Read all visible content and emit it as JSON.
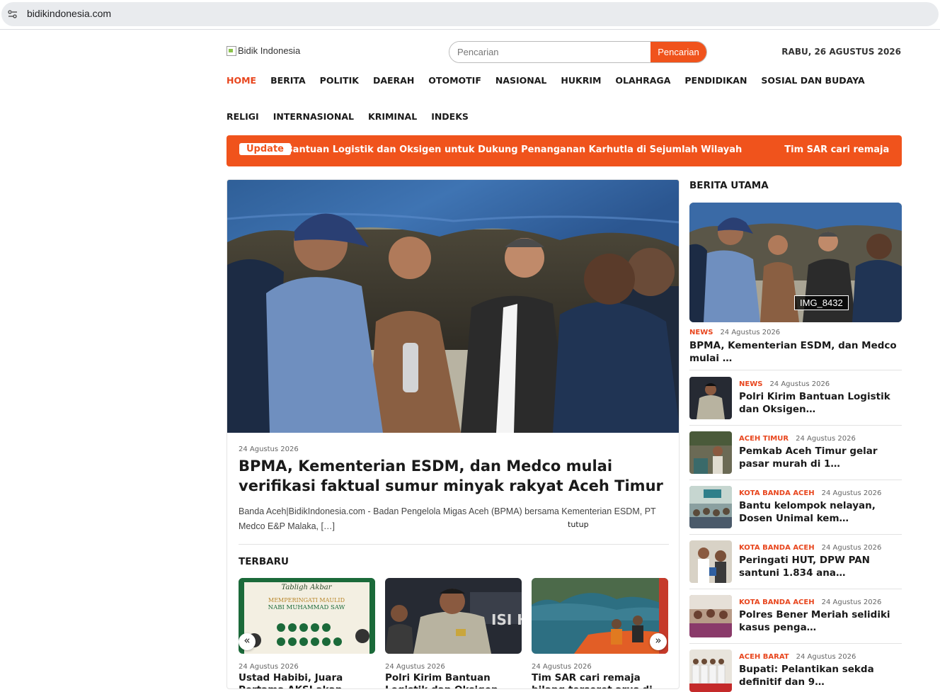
{
  "browser": {
    "url": "bidikindonesia.com"
  },
  "header": {
    "logo_alt": "Bidik Indonesia",
    "search_placeholder": "Pencarian",
    "search_button": "Pencarian",
    "date": "RABU, 26 AGUSTUS 2026"
  },
  "nav": [
    {
      "label": "HOME",
      "active": true
    },
    {
      "label": "BERITA"
    },
    {
      "label": "POLITIK"
    },
    {
      "label": "DAERAH"
    },
    {
      "label": "OTOMOTIF"
    },
    {
      "label": "NASIONAL"
    },
    {
      "label": "HUKRIM"
    },
    {
      "label": "OLAHRAGA"
    },
    {
      "label": "PENDIDIKAN"
    },
    {
      "label": "SOSIAL DAN BUDAYA"
    },
    {
      "label": "RELIGI"
    },
    {
      "label": "INTERNASIONAL"
    },
    {
      "label": "KRIMINAL"
    },
    {
      "label": "INDEKS"
    }
  ],
  "ticker": {
    "label": "Update",
    "items": [
      "Polri Kirim Bantuan Logistik dan Oksigen untuk Dukung Penanganan Karhutla di Sejumlah Wilayah",
      "Tim SAR cari remaja hilang terseret arus di Aceh Besar"
    ]
  },
  "hero": {
    "date": "24 Agustus 2026",
    "title": "BPMA, Kementerian ESDM, dan Medco mulai verifikasi faktual sumur minyak rakyat Aceh Timur",
    "excerpt": "Banda Aceh|BidikIndonesia.com - Badan Pengelola Migas Aceh (BPMA) bersama Kementerian ESDM, PT Medco E&P Malaka,  […]",
    "close_label": "tutup"
  },
  "latest": {
    "title": "TERBARU",
    "prev": "«",
    "next": "»",
    "items": [
      {
        "date": "24 Agustus 2026",
        "title": "Ustad Habibi, Juara Pertama AKSI akan Tampil Di Masjid"
      },
      {
        "date": "24 Agustus 2026",
        "title": "Polri Kirim Bantuan Logistik dan Oksigen untuk Dukung"
      },
      {
        "date": "24 Agustus 2026",
        "title": "Tim SAR cari remaja hilang terseret arus di Aceh Besar"
      }
    ]
  },
  "sidebar": {
    "title": "BERITA UTAMA",
    "feature": {
      "caption": "IMG_8432",
      "category": "NEWS",
      "date": "24 Agustus 2026",
      "title": "BPMA, Kementerian ESDM, dan Medco mulai …"
    },
    "items": [
      {
        "category": "NEWS",
        "date": "24 Agustus 2026",
        "title": "Polri Kirim Bantuan Logistik dan Oksigen…"
      },
      {
        "category": "ACEH TIMUR",
        "date": "24 Agustus 2026",
        "title": "Pemkab Aceh Timur gelar pasar murah di 1…"
      },
      {
        "category": "KOTA BANDA ACEH",
        "date": "24 Agustus 2026",
        "title": "Bantu kelompok nelayan, Dosen Unimal kem…"
      },
      {
        "category": "KOTA BANDA ACEH",
        "date": "24 Agustus 2026",
        "title": "Peringati HUT, DPW PAN santuni 1.834 ana…"
      },
      {
        "category": "KOTA BANDA ACEH",
        "date": "24 Agustus 2026",
        "title": "Polres Bener Meriah selidiki kasus penga…"
      },
      {
        "category": "ACEH BARAT",
        "date": "24 Agustus 2026",
        "title": "Bupati: Pelantikan sekda definitif dan 9…"
      }
    ]
  },
  "colors": {
    "accent": "#f0531c",
    "category": "#e8461e"
  }
}
